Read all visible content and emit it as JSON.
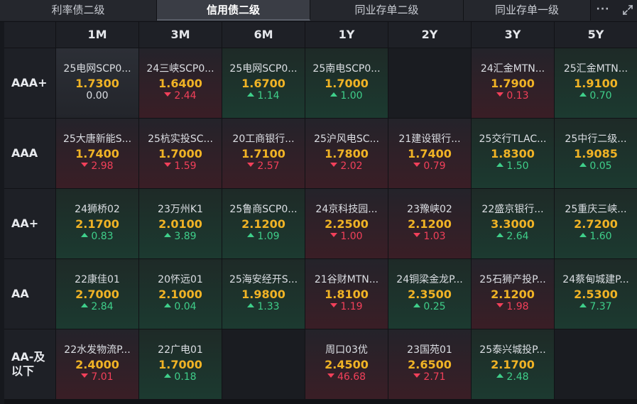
{
  "tabs": [
    {
      "label": "利率债二级",
      "active": false
    },
    {
      "label": "信用债二级",
      "active": true
    },
    {
      "label": "同业存单二级",
      "active": false
    },
    {
      "label": "同业存单一级",
      "active": false
    }
  ],
  "tab_more_label": "···",
  "icons": {
    "more": "more-dots-icon",
    "expand": "expand-icon"
  },
  "colors": {
    "rate": "#f0b325",
    "up": "#3fcf8a",
    "down": "#f2405a"
  },
  "columns": [
    "1M",
    "3M",
    "6M",
    "1Y",
    "2Y",
    "3Y",
    "5Y"
  ],
  "rows": [
    {
      "label": "AAA+",
      "cells": [
        {
          "name": "25电网SCP0...",
          "rate": "1.7300",
          "change": "0.00",
          "dir": "flat"
        },
        {
          "name": "24三峡SCP0...",
          "rate": "1.6400",
          "change": "2.44",
          "dir": "down"
        },
        {
          "name": "25电网SCP0...",
          "rate": "1.6700",
          "change": "1.14",
          "dir": "up"
        },
        {
          "name": "25南电SCP0...",
          "rate": "1.7000",
          "change": "1.00",
          "dir": "up"
        },
        null,
        {
          "name": "24汇金MTN...",
          "rate": "1.7900",
          "change": "0.13",
          "dir": "down"
        },
        {
          "name": "25汇金MTN...",
          "rate": "1.9100",
          "change": "0.70",
          "dir": "up"
        }
      ]
    },
    {
      "label": "AAA",
      "cells": [
        {
          "name": "25大唐新能S...",
          "rate": "1.7400",
          "change": "2.98",
          "dir": "down"
        },
        {
          "name": "25杭实投SC...",
          "rate": "1.7000",
          "change": "1.59",
          "dir": "down"
        },
        {
          "name": "20工商银行...",
          "rate": "1.7100",
          "change": "2.57",
          "dir": "down"
        },
        {
          "name": "25沪风电SC...",
          "rate": "1.7800",
          "change": "2.02",
          "dir": "down"
        },
        {
          "name": "21建设银行...",
          "rate": "1.7400",
          "change": "0.79",
          "dir": "down"
        },
        {
          "name": "25交行TLAC...",
          "rate": "1.8300",
          "change": "1.50",
          "dir": "up"
        },
        {
          "name": "25中行二级...",
          "rate": "1.9085",
          "change": "0.05",
          "dir": "up"
        }
      ]
    },
    {
      "label": "AA+",
      "cells": [
        {
          "name": "24狮桥02",
          "rate": "2.1700",
          "change": "0.83",
          "dir": "up"
        },
        {
          "name": "23万州K1",
          "rate": "2.0100",
          "change": "3.89",
          "dir": "up"
        },
        {
          "name": "25鲁商SCP0...",
          "rate": "2.1200",
          "change": "1.09",
          "dir": "up"
        },
        {
          "name": "24京科技园...",
          "rate": "2.2500",
          "change": "1.00",
          "dir": "down"
        },
        {
          "name": "23豫峡02",
          "rate": "2.1200",
          "change": "1.03",
          "dir": "down"
        },
        {
          "name": "22盛京银行...",
          "rate": "3.3000",
          "change": "2.64",
          "dir": "up"
        },
        {
          "name": "25重庆三峡...",
          "rate": "2.7200",
          "change": "1.60",
          "dir": "up"
        }
      ]
    },
    {
      "label": "AA",
      "cells": [
        {
          "name": "22康佳01",
          "rate": "2.7000",
          "change": "2.84",
          "dir": "up"
        },
        {
          "name": "20怀远01",
          "rate": "2.1000",
          "change": "0.04",
          "dir": "up"
        },
        {
          "name": "25海安经开S...",
          "rate": "1.9800",
          "change": "1.33",
          "dir": "up"
        },
        {
          "name": "21谷财MTN...",
          "rate": "1.8100",
          "change": "1.19",
          "dir": "down"
        },
        {
          "name": "24铜梁金龙P...",
          "rate": "2.3500",
          "change": "0.25",
          "dir": "up"
        },
        {
          "name": "25石狮产投P...",
          "rate": "2.1200",
          "change": "1.98",
          "dir": "down"
        },
        {
          "name": "24蔡甸城建P...",
          "rate": "2.5300",
          "change": "7.37",
          "dir": "up"
        }
      ]
    },
    {
      "label": "AA-及以下",
      "label_lines": [
        "AA-及",
        "以下"
      ],
      "cells": [
        {
          "name": "22水发物流P...",
          "rate": "2.4000",
          "change": "7.01",
          "dir": "down"
        },
        {
          "name": "22广电01",
          "rate": "1.7000",
          "change": "0.18",
          "dir": "up"
        },
        null,
        {
          "name": "周口03优",
          "rate": "2.4500",
          "change": "46.68",
          "dir": "down"
        },
        {
          "name": "23国苑01",
          "rate": "2.6500",
          "change": "2.71",
          "dir": "down"
        },
        {
          "name": "25泰兴城投P...",
          "rate": "2.1700",
          "change": "2.48",
          "dir": "up"
        },
        null
      ]
    }
  ]
}
